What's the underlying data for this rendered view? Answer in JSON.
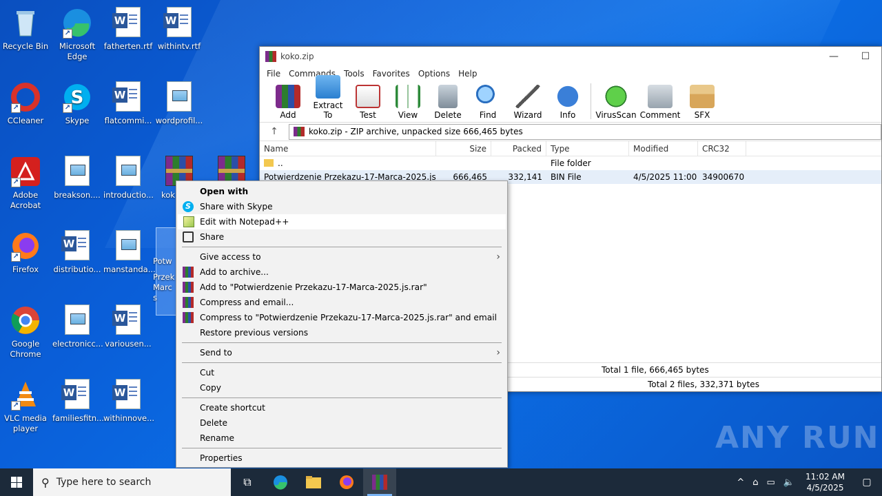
{
  "desktop": {
    "icons": [
      {
        "label": "Recycle Bin",
        "kind": "recycle"
      },
      {
        "label": "Microsoft Edge",
        "kind": "edge"
      },
      {
        "label": "fatherten.rtf",
        "kind": "word"
      },
      {
        "label": "withintv.rtf",
        "kind": "word"
      },
      {
        "label": "CCleaner",
        "kind": "ccleaner"
      },
      {
        "label": "Skype",
        "kind": "skype"
      },
      {
        "label": "flatcommi...",
        "kind": "word"
      },
      {
        "label": "wordprofil...",
        "kind": "image"
      },
      {
        "label": "Adobe Acrobat",
        "kind": "acrobat"
      },
      {
        "label": "breakson....",
        "kind": "image"
      },
      {
        "label": "introductio...",
        "kind": "image"
      },
      {
        "label": "kok",
        "kind": "rar"
      },
      {
        "label": "",
        "kind": "rar"
      },
      {
        "label": "Firefox",
        "kind": "firefox"
      },
      {
        "label": "distributio...",
        "kind": "word"
      },
      {
        "label": "manstanda...",
        "kind": "image"
      },
      {
        "label": "Potw",
        "kind": "selected-js"
      },
      {
        "label": "Google Chrome",
        "kind": "chrome"
      },
      {
        "label": "electronicc...",
        "kind": "image"
      },
      {
        "label": "variousen...",
        "kind": "word"
      },
      {
        "label": "VLC media player",
        "kind": "vlc"
      },
      {
        "label": "familiesfitn...",
        "kind": "word"
      },
      {
        "label": "withinnove...",
        "kind": "word"
      }
    ],
    "selected_partial_label": "Przek Marc s"
  },
  "winrar": {
    "title": "koko.zip",
    "menu": [
      "File",
      "Commands",
      "Tools",
      "Favorites",
      "Options",
      "Help"
    ],
    "toolbar": [
      "Add",
      "Extract To",
      "Test",
      "View",
      "Delete",
      "Find",
      "Wizard",
      "Info",
      "VirusScan",
      "Comment",
      "SFX"
    ],
    "address": "koko.zip - ZIP archive, unpacked size 666,465 bytes",
    "columns": [
      "Name",
      "Size",
      "Packed",
      "Type",
      "Modified",
      "CRC32"
    ],
    "rows": [
      {
        "name": "..",
        "size": "",
        "packed": "",
        "type": "File folder",
        "modified": "",
        "crc": ""
      },
      {
        "name": "Potwierdzenie Przekazu-17-Marca-2025.js",
        "size": "666,465",
        "packed": "332,141",
        "type": "BIN File",
        "modified": "4/5/2025 11:00 ...",
        "crc": "34900670"
      }
    ],
    "status1": "Total 1 file, 666,465 bytes",
    "status2": "Total 2 files, 332,371 bytes"
  },
  "context_menu": {
    "open_with": "Open with",
    "share_skype": "Share with Skype",
    "edit_npp": "Edit with Notepad++",
    "share": "Share",
    "give_access": "Give access to",
    "add_archive": "Add to archive...",
    "add_to_rar": "Add to \"Potwierdzenie Przekazu-17-Marca-2025.js.rar\"",
    "compress_email": "Compress and email...",
    "compress_to_rar_email": "Compress to \"Potwierdzenie Przekazu-17-Marca-2025.js.rar\" and email",
    "restore": "Restore previous versions",
    "send_to": "Send to",
    "cut": "Cut",
    "copy": "Copy",
    "create_shortcut": "Create shortcut",
    "delete": "Delete",
    "rename": "Rename",
    "properties": "Properties"
  },
  "taskbar": {
    "search_placeholder": "Type here to search",
    "time": "11:02 AM",
    "date": "4/5/2025"
  },
  "watermark": "ANY RUN"
}
